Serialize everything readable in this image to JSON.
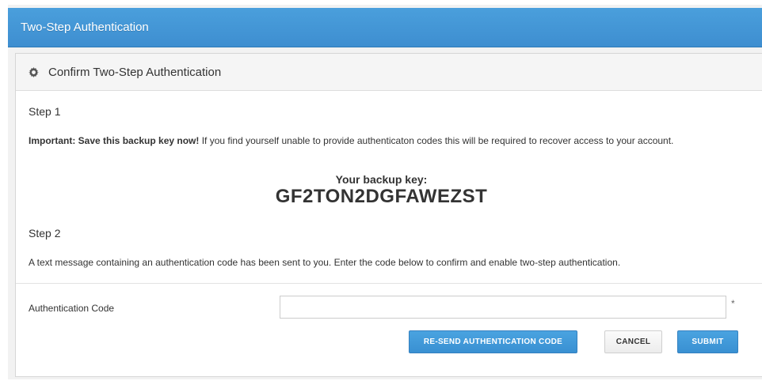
{
  "header": {
    "title": "Two-Step Authentication"
  },
  "panel": {
    "title": "Confirm Two-Step Authentication",
    "icon": "gear-icon",
    "step1": {
      "heading": "Step 1",
      "important_bold": "Important: Save this backup key now!",
      "important_text": " If you find yourself unable to provide authenticaton codes this will be required to recover access to your account.",
      "key_label": "Your backup key:",
      "key_value": "GF2TON2DGFAWEZST"
    },
    "step2": {
      "heading": "Step 2",
      "message": "A text message containing an authentication code has been sent to you. Enter the code below to confirm and enable two-step authentication."
    },
    "form": {
      "code_label": "Authentication Code",
      "code_value": "",
      "required_marker": "*"
    },
    "buttons": {
      "resend": "RE-SEND AUTHENTICATION CODE",
      "cancel": "CANCEL",
      "submit": "SUBMIT"
    }
  },
  "colors": {
    "header_blue": "#3e8ed0",
    "button_blue": "#3990d2"
  }
}
